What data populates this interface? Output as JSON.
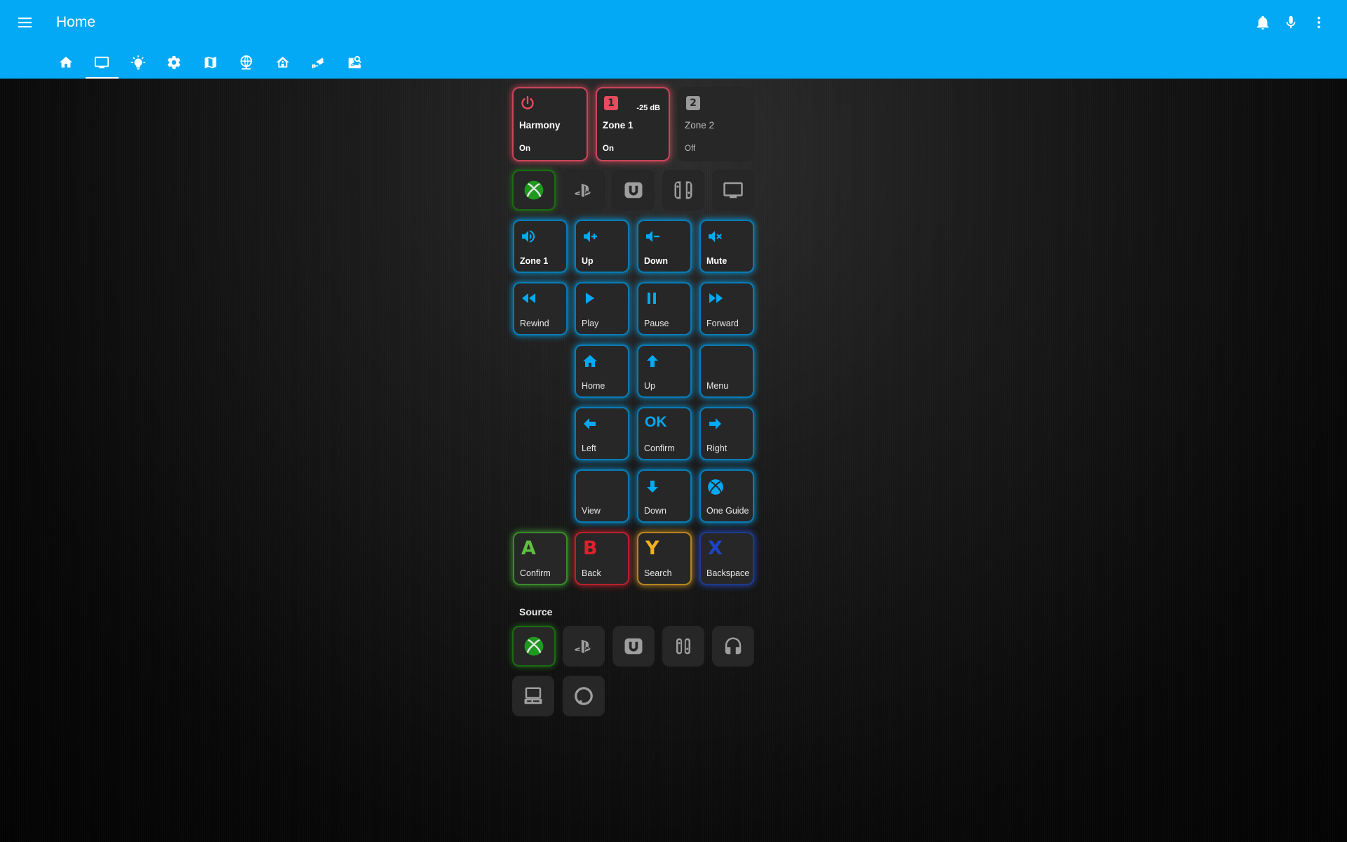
{
  "app": {
    "title": "Home"
  },
  "tabs": [
    {
      "icon": "home-icon"
    },
    {
      "icon": "television-icon",
      "active": true
    },
    {
      "icon": "lightbulb-icon"
    },
    {
      "icon": "gear-icon"
    },
    {
      "icon": "map-icon"
    },
    {
      "icon": "web-icon"
    },
    {
      "icon": "home-network-icon"
    },
    {
      "icon": "cctv-icon"
    },
    {
      "icon": "image-search-icon"
    }
  ],
  "top_actions": [
    "bell-icon",
    "microphone-icon",
    "more-vertical-icon"
  ],
  "entities": {
    "harmony": {
      "name": "Harmony",
      "state": "On",
      "icon": "power-icon"
    },
    "zone1": {
      "name": "Zone 1",
      "state": "On",
      "volume": "-25 dB",
      "badge": "1"
    },
    "zone2": {
      "name": "Zone 2",
      "state": "Off",
      "badge": "2"
    }
  },
  "activity_icons": [
    "xbox-icon",
    "playstation-icon",
    "wii-u-icon",
    "nintendo-switch-icon",
    "monitor-icon"
  ],
  "volume_row": [
    {
      "label": "Zone 1",
      "icon": "volume-high-icon"
    },
    {
      "label": "Up",
      "icon": "volume-plus-icon"
    },
    {
      "label": "Down",
      "icon": "volume-minus-icon"
    },
    {
      "label": "Mute",
      "icon": "volume-mute-icon"
    }
  ],
  "media_row": [
    {
      "label": "Rewind",
      "icon": "rewind-icon"
    },
    {
      "label": "Play",
      "icon": "play-icon"
    },
    {
      "label": "Pause",
      "icon": "pause-icon"
    },
    {
      "label": "Forward",
      "icon": "fast-forward-icon"
    }
  ],
  "nav_row1": [
    {
      "label": "Home",
      "icon": "home-icon"
    },
    {
      "label": "Up",
      "icon": "arrow-up-icon"
    },
    {
      "label": "Menu",
      "icon": ""
    }
  ],
  "nav_row2": [
    {
      "label": "Left",
      "icon": "arrow-left-icon"
    },
    {
      "label": "Confirm",
      "icon": "ok-text",
      "text": "OK"
    },
    {
      "label": "Right",
      "icon": "arrow-right-icon"
    }
  ],
  "nav_row3": [
    {
      "label": "View",
      "icon": ""
    },
    {
      "label": "Down",
      "icon": "arrow-down-icon"
    },
    {
      "label": "One Guide",
      "icon": "xbox-icon"
    }
  ],
  "face_buttons": [
    {
      "letter": "A",
      "label": "Confirm",
      "color": "#5fbf3f"
    },
    {
      "letter": "B",
      "label": "Back",
      "color": "#e0202e"
    },
    {
      "letter": "Y",
      "label": "Search",
      "color": "#f0b020"
    },
    {
      "letter": "X",
      "label": "Backspace",
      "color": "#1c44c8"
    }
  ],
  "source": {
    "title": "Source",
    "icons": [
      "xbox-icon",
      "playstation-icon",
      "wii-u-icon",
      "nintendo-switch-icon",
      "headphones-icon",
      "laptop-icon",
      "amazon-alexa-icon"
    ]
  },
  "colors": {
    "accent": "#03a9f4",
    "harmony_red": "#e84b5f",
    "xbox_green": "#1f9a1f",
    "tile_bg": "#272727"
  }
}
